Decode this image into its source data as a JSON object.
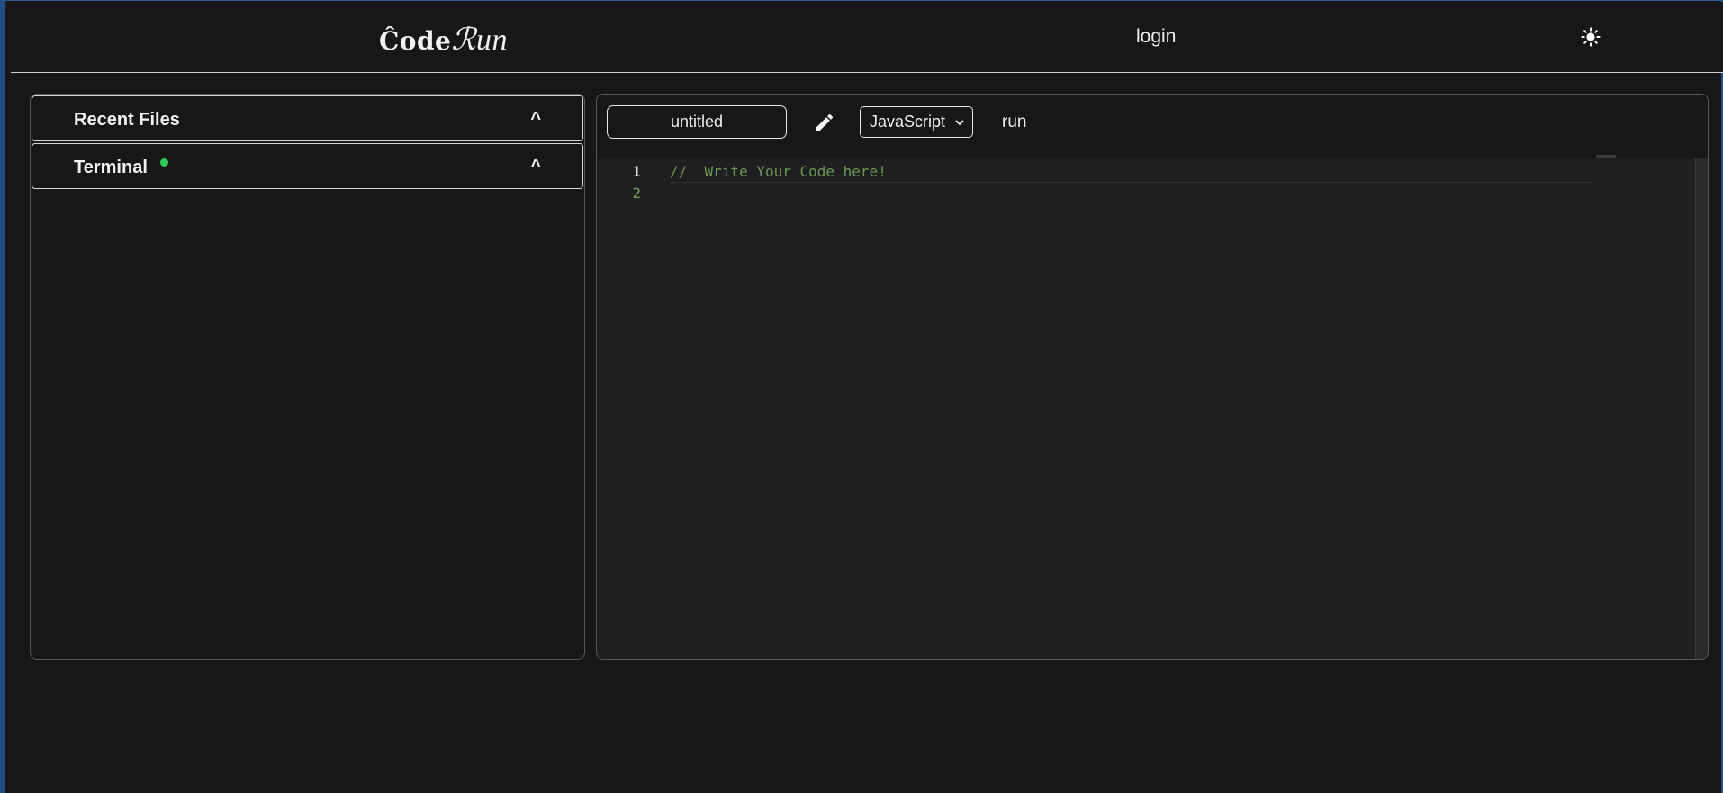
{
  "header": {
    "logo_prefix": "Ĉode",
    "logo_script": "ℛun",
    "login_label": "login",
    "theme_icon": "sun-icon"
  },
  "sidebar": {
    "items": [
      {
        "label": "Recent Files",
        "caret": "^",
        "status": ""
      },
      {
        "label": "Terminal",
        "caret": "^",
        "status": "online"
      }
    ]
  },
  "editor": {
    "filename": "untitled",
    "edit_icon": "pencil-icon",
    "language": "JavaScript",
    "run_label": "run",
    "lines": [
      {
        "number": "1",
        "text": "//  Write Your Code here!"
      },
      {
        "number": "2",
        "text": ""
      }
    ]
  },
  "colors": {
    "background": "#171718",
    "editor_background": "#1f1f20",
    "comment": "#6a9955",
    "status_online": "#2ecc59",
    "frame_accent": "#1d4e86"
  }
}
